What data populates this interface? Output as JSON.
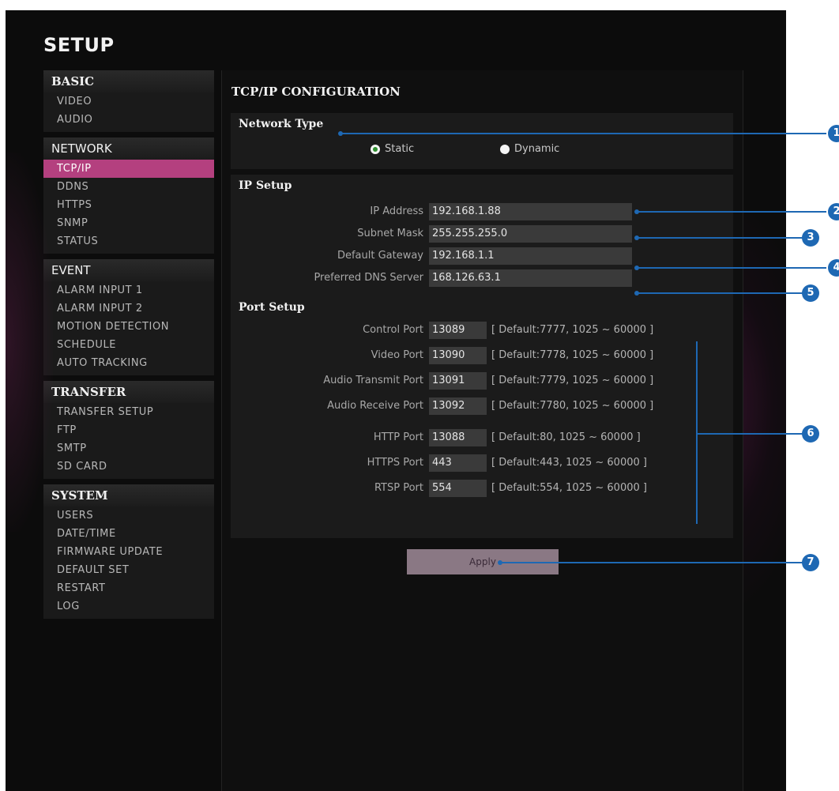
{
  "page": {
    "title": "SETUP"
  },
  "sidebar": {
    "groups": [
      {
        "title": "BASIC",
        "items": [
          "VIDEO",
          "AUDIO"
        ]
      },
      {
        "title": "NETWORK",
        "items": [
          "TCP/IP",
          "DDNS",
          "HTTPS",
          "SNMP",
          "STATUS"
        ],
        "active": "TCP/IP"
      },
      {
        "title": "EVENT",
        "items": [
          "ALARM INPUT 1",
          "ALARM INPUT 2",
          "MOTION DETECTION",
          "SCHEDULE",
          "AUTO TRACKING"
        ]
      },
      {
        "title": "TRANSFER",
        "items": [
          "TRANSFER SETUP",
          "FTP",
          "SMTP",
          "SD CARD"
        ]
      },
      {
        "title": "SYSTEM",
        "items": [
          "USERS",
          "DATE/TIME",
          "FIRMWARE UPDATE",
          "DEFAULT SET",
          "RESTART",
          "LOG"
        ]
      }
    ]
  },
  "main": {
    "title": "TCP/IP CONFIGURATION",
    "network_type": {
      "title": "Network Type",
      "options": [
        "Static",
        "Dynamic"
      ],
      "selected": "Static"
    },
    "ip_setup": {
      "title": "IP Setup",
      "fields": [
        {
          "label": "IP Address",
          "value": "192.168.1.88"
        },
        {
          "label": "Subnet Mask",
          "value": "255.255.255.0"
        },
        {
          "label": "Default Gateway",
          "value": "192.168.1.1"
        },
        {
          "label": "Preferred DNS Server",
          "value": "168.126.63.1"
        }
      ]
    },
    "port_setup": {
      "title": "Port Setup",
      "ports": [
        {
          "label": "Control Port",
          "value": "13089",
          "hint": "[ Default:7777, 1025 ~ 60000 ]"
        },
        {
          "label": "Video Port",
          "value": "13090",
          "hint": "[ Default:7778, 1025 ~ 60000 ]"
        },
        {
          "label": "Audio Transmit Port",
          "value": "13091",
          "hint": "[ Default:7779, 1025 ~ 60000 ]"
        },
        {
          "label": "Audio Receive Port",
          "value": "13092",
          "hint": "[ Default:7780, 1025 ~ 60000 ]"
        },
        {
          "label": "HTTP Port",
          "value": "13088",
          "hint": "[ Default:80, 1025 ~ 60000 ]"
        },
        {
          "label": "HTTPS Port",
          "value": "443",
          "hint": "[ Default:443, 1025 ~ 60000 ]"
        },
        {
          "label": "RTSP Port",
          "value": "554",
          "hint": "[ Default:554, 1025 ~ 60000 ]"
        }
      ]
    },
    "apply_label": "Apply"
  },
  "callouts": [
    "1",
    "2",
    "3",
    "4",
    "5",
    "6",
    "7"
  ],
  "colors": {
    "accent": "#b4407f",
    "callout": "#1e68b3",
    "background": "#0c0c0c"
  }
}
